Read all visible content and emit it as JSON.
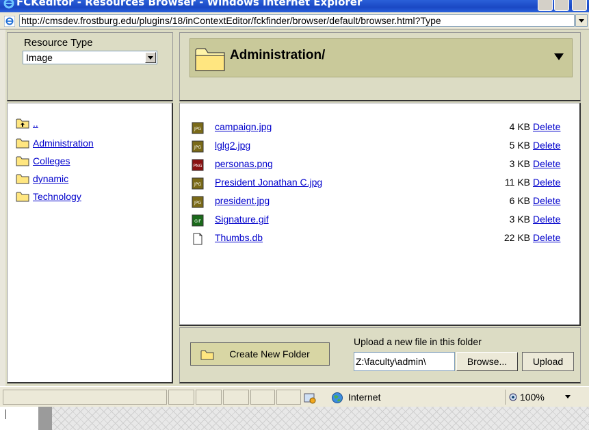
{
  "window": {
    "title": "FCKeditor - Resources Browser - Windows Internet Explorer"
  },
  "address_bar": {
    "url": "http://cmsdev.frostburg.edu/plugins/18/inContextEditor/fckfinder/browser/default/browser.html?Type"
  },
  "resource_type": {
    "label": "Resource Type",
    "selected": "Image"
  },
  "current_folder": {
    "path": "Administration/"
  },
  "folders": [
    {
      "label": ".."
    },
    {
      "label": "Administration"
    },
    {
      "label": "Colleges"
    },
    {
      "label": "dynamic"
    },
    {
      "label": "Technology"
    }
  ],
  "files": [
    {
      "name": "campaign.jpg",
      "size": "4 KB",
      "action": "Delete",
      "type": "jpg"
    },
    {
      "name": "lglg2.jpg",
      "size": "5 KB",
      "action": "Delete",
      "type": "jpg"
    },
    {
      "name": "personas.png",
      "size": "3 KB",
      "action": "Delete",
      "type": "png"
    },
    {
      "name": "President Jonathan C.jpg",
      "size": "11 KB",
      "action": "Delete",
      "type": "jpg"
    },
    {
      "name": "president.jpg",
      "size": "6 KB",
      "action": "Delete",
      "type": "jpg"
    },
    {
      "name": "Signature.gif",
      "size": "3 KB",
      "action": "Delete",
      "type": "gif"
    },
    {
      "name": "Thumbs.db",
      "size": "22 KB",
      "action": "Delete",
      "type": "file"
    }
  ],
  "actions": {
    "create_folder": "Create New Folder",
    "upload_label": "Upload a new file in this folder",
    "upload_value": "Z:\\faculty\\admin\\",
    "browse": "Browse...",
    "upload": "Upload"
  },
  "status_bar": {
    "zone": "Internet",
    "zoom": "100%"
  }
}
